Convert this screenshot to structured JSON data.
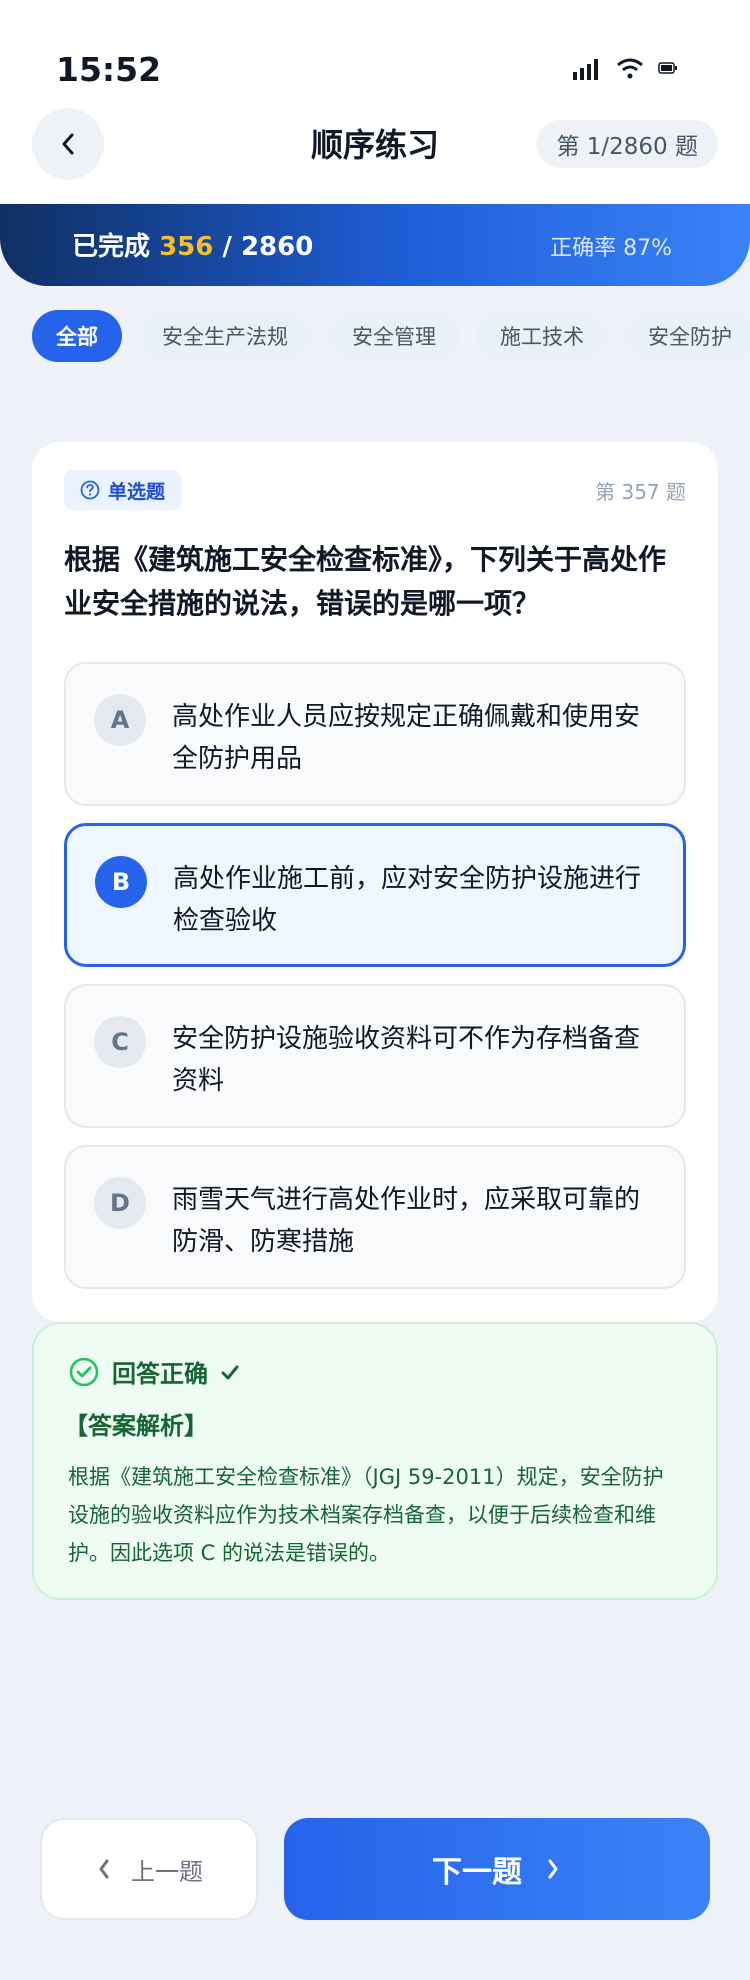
{
  "status": {
    "time": "15:52"
  },
  "header": {
    "title": "顺序练习",
    "counter": "第 1/2860 题"
  },
  "progress": {
    "label": "已完成",
    "done": "356",
    "total": "/ 2860",
    "accuracy": "正确率 87%"
  },
  "tabs": [
    {
      "label": "全部"
    },
    {
      "label": "安全生产法规"
    },
    {
      "label": "安全管理"
    },
    {
      "label": "施工技术"
    },
    {
      "label": "安全防护"
    }
  ],
  "question": {
    "type": "单选题",
    "number": "第 357 题",
    "text": "根据《建筑施工安全检查标准》，下列关于高处作业安全措施的说法，错误的是哪一项？",
    "options": [
      {
        "letter": "A",
        "text": "高处作业人员应按规定正确佩戴和使用安全防护用品"
      },
      {
        "letter": "B",
        "text": "高处作业施工前，应对安全防护设施进行检查验收"
      },
      {
        "letter": "C",
        "text": "安全防护设施验收资料可不作为存档备查资料"
      },
      {
        "letter": "D",
        "text": "雨雪天气进行高处作业时，应采取可靠的防滑、防寒措施"
      }
    ]
  },
  "answer": {
    "title": "回答正确",
    "analysis_title": "【答案解析】",
    "analysis_text": "根据《建筑施工安全检查标准》（JGJ 59-2011）规定，安全防护设施的验收资料应作为技术档案存档备查，以便于后续检查和维护。因此选项 C 的说法是错误的。"
  },
  "footer": {
    "prev": "上一题",
    "next": "下一题"
  },
  "colors": {
    "primary": "#2563eb",
    "accent": "#fbbf24",
    "success": "#166534"
  }
}
